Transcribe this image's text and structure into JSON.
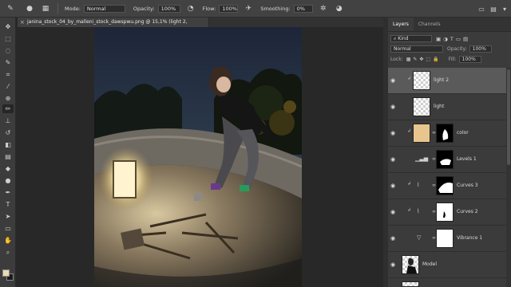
{
  "options_bar": {
    "mode_label": "Mode:",
    "mode_value": "Normal",
    "opacity_label": "Opacity:",
    "opacity_value": "100%",
    "flow_label": "Flow:",
    "flow_value": "100%",
    "smoothing_label": "Smoothing:",
    "smoothing_value": "0%"
  },
  "document": {
    "tab_title": "janina_stock_04_by_malleni_stock_dawspwu.png @ 15,1% (light 2,"
  },
  "panel": {
    "tabs": [
      "Layers",
      "Channels"
    ],
    "filter_value": "Kind",
    "blend_mode": "Normal",
    "opacity_label": "Opacity:",
    "opacity_value": "100%",
    "lock_label": "Lock:",
    "fill_label": "Fill:",
    "fill_value": "100%"
  },
  "layers": [
    {
      "name": "light 2",
      "selected": true
    },
    {
      "name": "light",
      "selected": false
    },
    {
      "name": "color",
      "selected": false
    },
    {
      "name": "Levels 1",
      "selected": false
    },
    {
      "name": "Curves 3",
      "selected": false
    },
    {
      "name": "Curves 2",
      "selected": false
    },
    {
      "name": "Vibrance 1",
      "selected": false
    },
    {
      "name": "Model",
      "selected": false
    }
  ],
  "colors": {
    "foreground": "#e8d9b8",
    "background": "#1a1a1a",
    "color_thumb": "#e7c58c"
  },
  "icons": {
    "tools": [
      "move-icon",
      "marquee-icon",
      "lasso-icon",
      "quick-select-icon",
      "crop-icon",
      "eyedropper-icon",
      "healing-icon",
      "brush-icon",
      "stamp-icon",
      "history-brush-icon",
      "eraser-icon",
      "gradient-icon",
      "blur-icon",
      "dodge-icon",
      "pen-icon",
      "type-icon",
      "path-select-icon",
      "rectangle-icon",
      "hand-icon",
      "zoom-icon"
    ]
  }
}
